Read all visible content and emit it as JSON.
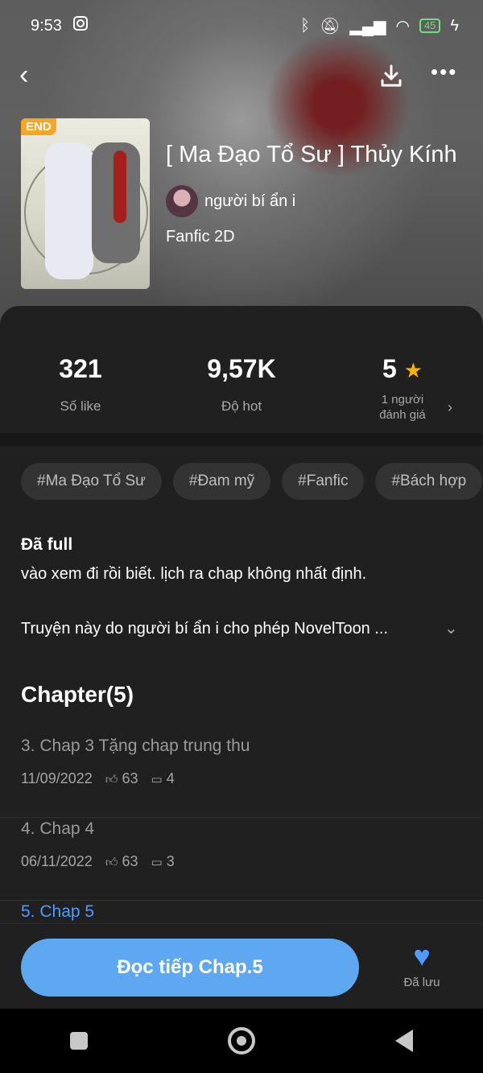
{
  "status_bar": {
    "time": "9:53",
    "battery": "45"
  },
  "book": {
    "badge": "END",
    "title": "[ Ma Đạo Tổ Sư ] Thủy Kính",
    "author": "người bí ẩn i",
    "category": "Fanfic 2D"
  },
  "stats": {
    "likes_value": "321",
    "likes_label": "Số like",
    "hot_value": "9,57K",
    "hot_label": "Độ hot",
    "rating_value": "5",
    "rating_label_line1": "1 người",
    "rating_label_line2": "đánh giá"
  },
  "tags": [
    "#Ma Đạo Tổ Sư",
    "#Đam mỹ",
    "#Fanfic",
    "#Bách hợp"
  ],
  "description": {
    "status": "Đã full",
    "text": "vào xem đi rồi biết. lịch ra chap không nhất định.",
    "permission": "Truyện này do người bí ẩn i cho phép NovelToon ..."
  },
  "chapters": {
    "title": "Chapter(5)",
    "items": [
      {
        "name": "3. Chap 3 Tặng chap trung thu",
        "date": "11/09/2022",
        "likes": "63",
        "comments": "4"
      },
      {
        "name": "4. Chap 4",
        "date": "06/11/2022",
        "likes": "63",
        "comments": "3"
      },
      {
        "name": "5. Chap 5"
      }
    ]
  },
  "bottom": {
    "read_button": "Đọc tiếp Chap.5",
    "saved_label": "Đã lưu"
  },
  "colors": {
    "accent": "#5ea8f2",
    "badge": "#f5a623",
    "star": "#f5b400"
  }
}
